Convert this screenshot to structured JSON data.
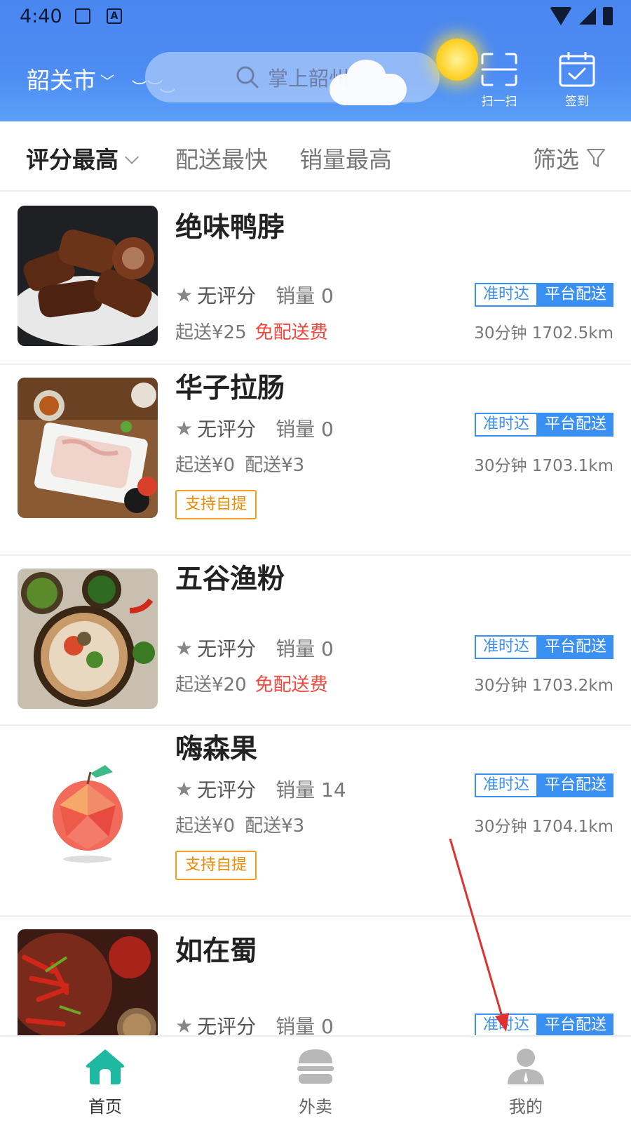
{
  "status_bar": {
    "time": "4:40"
  },
  "header": {
    "city": "韶关市",
    "search_placeholder": "掌上韶州",
    "scan_label": "扫一扫",
    "signin_label": "签到"
  },
  "sort_bar": {
    "items": [
      "评分最高",
      "配送最快",
      "销量最高"
    ],
    "filter_label": "筛选"
  },
  "stores": [
    {
      "name": "绝味鸭脖",
      "rating": "无评分",
      "sales": "销量 0",
      "min_order": "起送¥25",
      "delivery_fee": "免配送费",
      "badge1": "准时达",
      "badge2": "平台配送",
      "eta_distance": "30分钟 1702.5km",
      "pickup": ""
    },
    {
      "name": "华子拉肠",
      "rating": "无评分",
      "sales": "销量 0",
      "min_order": "起送¥0",
      "delivery_fee": "配送¥3",
      "badge1": "准时达",
      "badge2": "平台配送",
      "eta_distance": "30分钟 1703.1km",
      "pickup": "支持自提"
    },
    {
      "name": "五谷渔粉",
      "rating": "无评分",
      "sales": "销量 0",
      "min_order": "起送¥20",
      "delivery_fee": "免配送费",
      "badge1": "准时达",
      "badge2": "平台配送",
      "eta_distance": "30分钟 1703.2km",
      "pickup": ""
    },
    {
      "name": "嗨森果",
      "rating": "无评分",
      "sales": "销量 14",
      "min_order": "起送¥0",
      "delivery_fee": "配送¥3",
      "badge1": "准时达",
      "badge2": "平台配送",
      "eta_distance": "30分钟 1704.1km",
      "pickup": "支持自提"
    },
    {
      "name": "如在蜀",
      "rating": "无评分",
      "sales": "销量 0",
      "min_order": "",
      "delivery_fee": "",
      "badge1": "准时达",
      "badge2": "平台配送",
      "eta_distance": "",
      "pickup": ""
    }
  ],
  "bottom_nav": {
    "home": "首页",
    "takeout": "外卖",
    "mine": "我的"
  },
  "colors": {
    "header_blue": "#4a86f0",
    "accent_blue": "#3a8ff2",
    "free_red": "#f0483e",
    "pickup_orange": "#f08a00",
    "home_green": "#1fb8a0",
    "annotation_red": "#e03030"
  },
  "icons": [
    "search-icon",
    "scan-icon",
    "calendar-check-icon",
    "chevron-down-icon",
    "filter-icon",
    "star-icon",
    "home-icon",
    "burger-icon",
    "user-icon"
  ]
}
